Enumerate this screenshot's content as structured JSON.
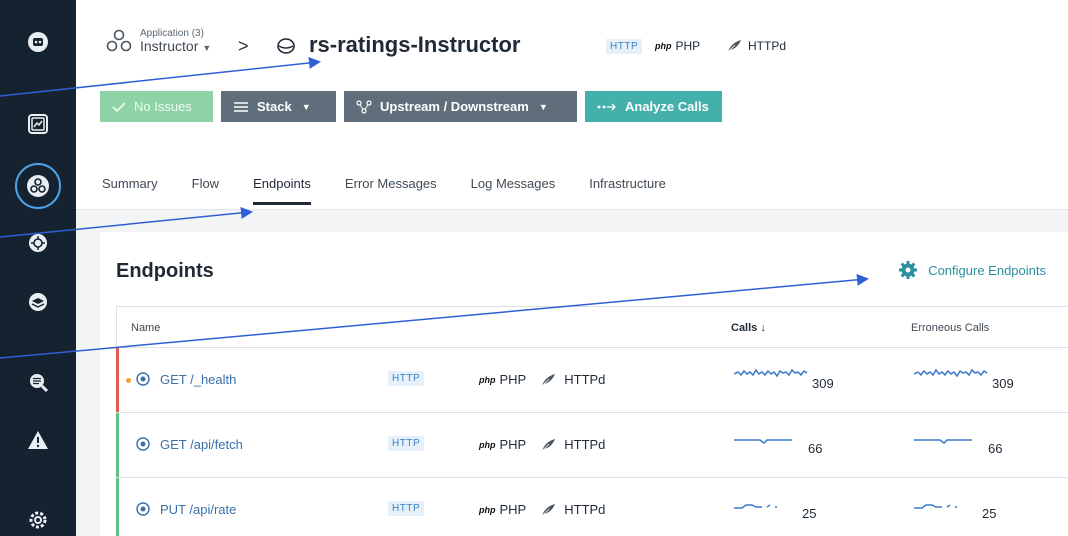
{
  "breadcrumb": {
    "application_kind": "Application (3)",
    "application_name": "Instructor",
    "separator": ">",
    "service_name": "rs-ratings-Instructor",
    "technologies": {
      "protocol": "HTTP",
      "php_logo": "php",
      "php": "PHP",
      "server": "HTTPd"
    }
  },
  "toolbar": {
    "no_issues_label": "No Issues",
    "stack_label": "Stack",
    "upstream_label": "Upstream / Downstream",
    "analyze_label": "Analyze Calls"
  },
  "tabs": [
    {
      "label": "Summary"
    },
    {
      "label": "Flow"
    },
    {
      "label": "Endpoints",
      "active": true
    },
    {
      "label": "Error Messages"
    },
    {
      "label": "Log Messages"
    },
    {
      "label": "Infrastructure"
    }
  ],
  "endpoints": {
    "title": "Endpoints",
    "configure_label": "Configure Endpoints",
    "columns": {
      "name": "Name",
      "calls": "Calls",
      "sort_arrow": "↓",
      "erroneous": "Erroneous Calls"
    },
    "rows": [
      {
        "name": "GET /_health",
        "protocol": "HTTP",
        "php_logo": "php",
        "tech": "PHP",
        "server": "HTTPd",
        "calls": "309",
        "erroneous": "309",
        "status": "error",
        "warning": true
      },
      {
        "name": "GET /api/fetch",
        "protocol": "HTTP",
        "php_logo": "php",
        "tech": "PHP",
        "server": "HTTPd",
        "calls": "66",
        "erroneous": "66",
        "status": "ok",
        "warning": false
      },
      {
        "name": "PUT /api/rate",
        "protocol": "HTTP",
        "php_logo": "php",
        "tech": "PHP",
        "server": "HTTPd",
        "calls": "25",
        "erroneous": "25",
        "status": "ok",
        "warning": false
      }
    ]
  },
  "colors": {
    "rail": "#14232f",
    "accent": "#4ea3e8",
    "no_issues": "#8ed2a5",
    "stack": "#5f6e7a",
    "analyze": "#44b0ab",
    "error_status": "#e05a55",
    "ok_status": "#62c08a",
    "warning_dot": "#f0a030",
    "annotation_arrow": "#2f5fd6"
  },
  "icons": {
    "rail": [
      "logo-icon",
      "dashboard-icon",
      "applications-icon",
      "kubernetes-icon",
      "infrastructure-icon",
      "analytics-icon",
      "events-icon",
      "settings-icon"
    ]
  }
}
